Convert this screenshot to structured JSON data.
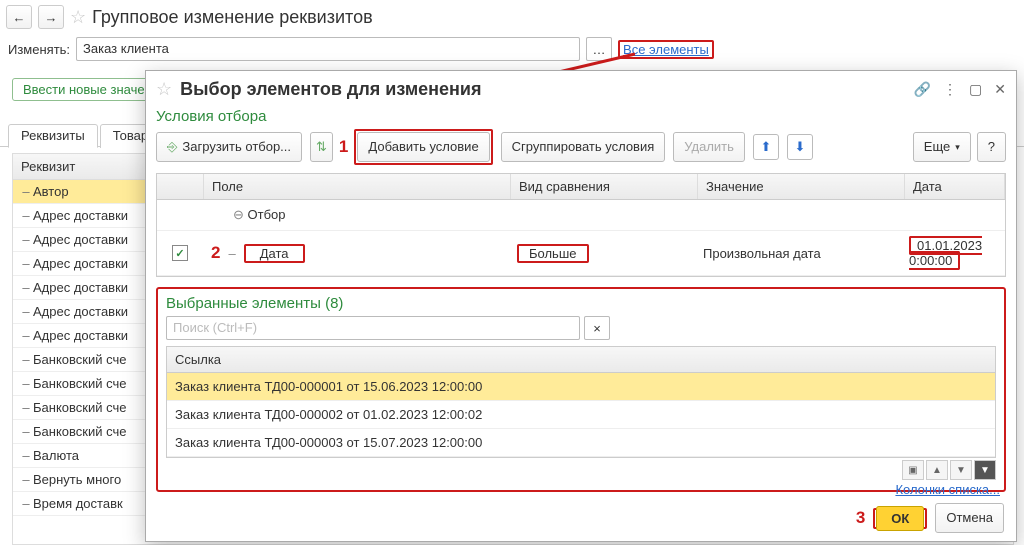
{
  "header": {
    "title": "Групповое изменение реквизитов",
    "change_label": "Изменять:",
    "change_value": "Заказ клиента",
    "all_elements_link": "Все элементы",
    "new_values_btn": "Ввести новые значе"
  },
  "tabs": {
    "t1": "Реквизиты",
    "t2": "Товар"
  },
  "req": {
    "header": "Реквизит",
    "items": [
      "Автор",
      "Адрес доставки",
      "Адрес доставки",
      "Адрес доставки",
      "Адрес доставки",
      "Адрес доставки",
      "Адрес доставки",
      "Банковский сче",
      "Банковский сче",
      "Банковский сче",
      "Банковский сче",
      "Валюта",
      "Вернуть много",
      "Время доставк"
    ]
  },
  "dialog": {
    "title": "Выбор элементов для изменения",
    "section1": "Условия отбора",
    "load_btn": "Загрузить отбор...",
    "add_cond_btn": "Добавить условие",
    "group_cond_btn": "Сгруппировать условия",
    "delete_btn": "Удалить",
    "more_btn": "Еще",
    "cond_headers": {
      "field": "Поле",
      "cmp": "Вид сравнения",
      "val": "Значение",
      "date": "Дата"
    },
    "otbor_label": "Отбор",
    "cond_row": {
      "field": "Дата",
      "cmp": "Больше",
      "val": "Произвольная дата",
      "date": "01.01.2023 0:00:00"
    },
    "selected_title": "Выбранные элементы (8)",
    "search_ph": "Поиск (Ctrl+F)",
    "link_header": "Ссылка",
    "rows": [
      "Заказ клиента ТД00-000001 от 15.06.2023 12:00:00",
      "Заказ клиента ТД00-000002 от 01.02.2023 12:00:02",
      "Заказ клиента ТД00-000003 от 15.07.2023 12:00:00"
    ],
    "columns_link": "Колонки списка...",
    "ok": "ОК",
    "cancel": "Отмена"
  },
  "annot": {
    "n1": "1",
    "n2": "2",
    "n3": "3"
  }
}
